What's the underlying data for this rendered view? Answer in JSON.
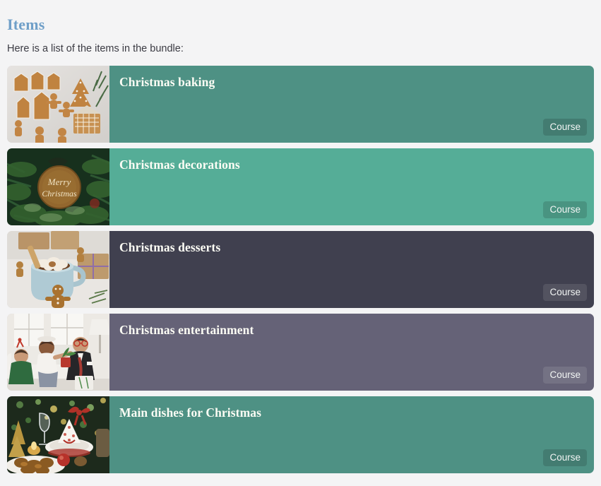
{
  "header": {
    "title": "Items",
    "subtitle": "Here is a list of the items in the bundle:",
    "title_color": "#6f9fc8"
  },
  "items": [
    {
      "title": "Christmas baking",
      "badge": "Course",
      "card_color": "#4e9184",
      "thumb_name": "gingerbread-cookies-thumbnail"
    },
    {
      "title": "Christmas decorations",
      "badge": "Course",
      "card_color": "#55ad97",
      "thumb_name": "merry-christmas-ornament-thumbnail"
    },
    {
      "title": "Christmas desserts",
      "badge": "Course",
      "card_color": "#40404f",
      "thumb_name": "hot-chocolate-mug-thumbnail"
    },
    {
      "title": "Christmas entertainment",
      "badge": "Course",
      "card_color": "#656277",
      "thumb_name": "family-on-couch-thumbnail"
    },
    {
      "title": "Main dishes for Christmas",
      "badge": "Course",
      "card_color": "#4e9184",
      "thumb_name": "christmas-dinner-table-thumbnail"
    }
  ]
}
